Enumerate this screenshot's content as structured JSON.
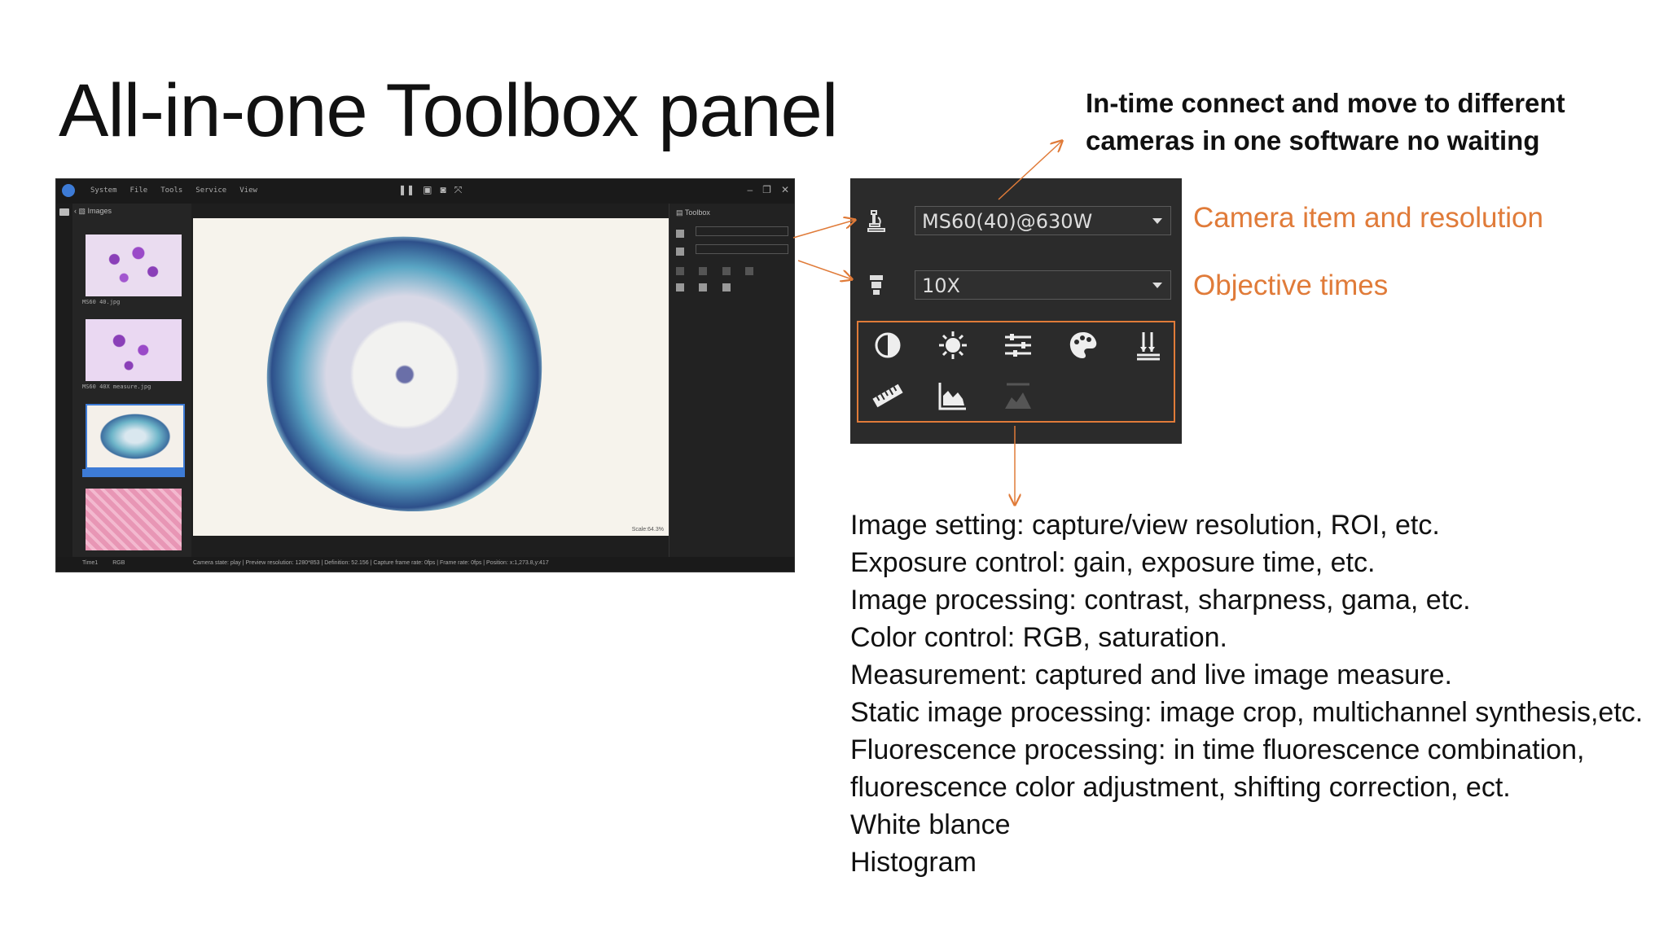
{
  "slide": {
    "title": "All-in-one Toolbox panel",
    "callout_top_line1": "In-time connect and move to different",
    "callout_top_line2": "cameras in one software no waiting",
    "label_camera": "Camera item and resolution",
    "label_objective": "Objective times"
  },
  "colors": {
    "accent_orange": "#e07b39",
    "app_dark": "#1e1e1e",
    "selection_blue": "#3d7bd6"
  },
  "app": {
    "menu": [
      "System",
      "File",
      "Tools",
      "Service",
      "View"
    ],
    "center_icons": [
      "pause-icon",
      "live-icon",
      "camera-icon",
      "fullscreen-icon"
    ],
    "left_panel_title": "Images",
    "thumbnails": [
      "MS60 40.jpg",
      "MS60 40X measure.jpg",
      "",
      ""
    ],
    "right_panel_title": "Toolbox",
    "scale": "Scale:64.3%",
    "status_time": "Time1",
    "status_mode": "RGB",
    "status_text": "Camera state: play | Preview resolution: 1280*853 | Definition: 52.156 | Capture frame rate: 0fps | Frame rate: 0fps | Position: x:1,273.8,y:417"
  },
  "toolbox": {
    "camera_value": "MS60(40)@630W",
    "objective_value": "10X",
    "tools_row1": [
      "contrast-icon",
      "exposure-icon",
      "adjust-sliders-icon",
      "color-palette-icon",
      "calibration-icon"
    ],
    "tools_row2": [
      "measure-ruler-icon",
      "histogram-icon",
      "fluorescence-icon"
    ]
  },
  "descriptions": [
    "Image setting: capture/view resolution, ROI, etc.",
    "Exposure control: gain, exposure time, etc.",
    "Image processing: contrast, sharpness, gama, etc.",
    "Color control: RGB, saturation.",
    "Measurement: captured and live image measure.",
    "Static image processing: image crop, multichannel synthesis,etc.",
    "Fluorescence processing:  in time fluorescence combination,",
    "fluorescence color adjustment, shifting correction, ect.",
    "White blance",
    "Histogram"
  ]
}
